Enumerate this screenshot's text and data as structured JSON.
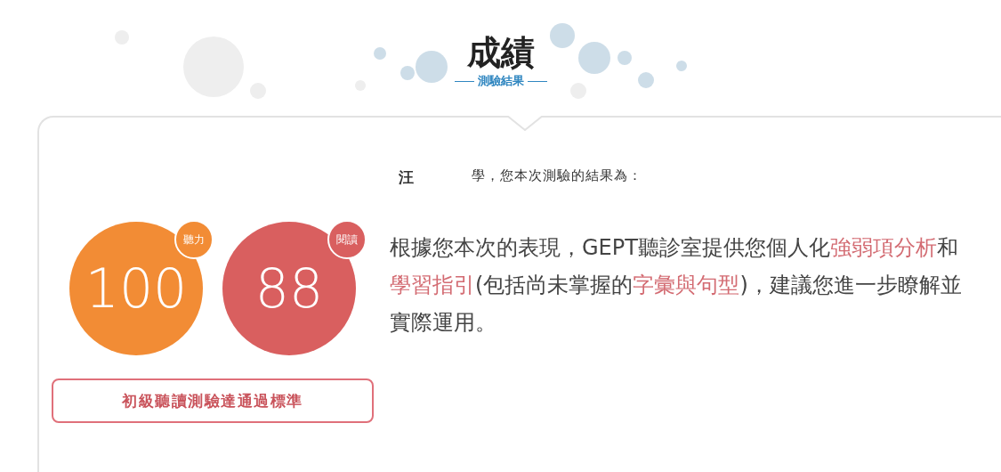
{
  "header": {
    "title": "成績",
    "subtitle": "測驗結果"
  },
  "greeting": {
    "name_fragment": "汪",
    "text": "學，您本次測驗的結果為："
  },
  "scores": [
    {
      "label": "聽力",
      "score": "100",
      "color": "#f28c35"
    },
    {
      "label": "閱讀",
      "score": "88",
      "color": "#d95f5f"
    }
  ],
  "result": "初級聽讀測驗達通過標準",
  "advice": [
    {
      "text": "根據您本次的表現，GEPT聽診室提供您個人化",
      "highlight": false
    },
    {
      "text": "強弱項分析",
      "highlight": true
    },
    {
      "text": "和",
      "highlight": false
    },
    {
      "text": "學習指引",
      "highlight": true
    },
    {
      "text": "(包括尚未掌握的",
      "highlight": false
    },
    {
      "text": "字彙與句型",
      "highlight": true
    },
    {
      "text": ")，建議您進一步瞭解並實際運用。",
      "highlight": false
    }
  ]
}
